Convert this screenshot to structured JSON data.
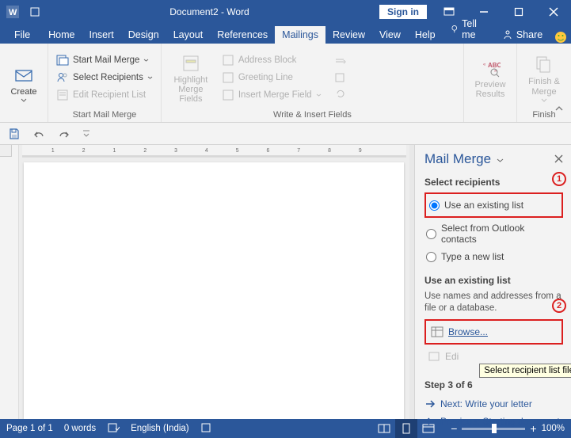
{
  "titlebar": {
    "title": "Document2 - Word",
    "signin": "Sign in"
  },
  "tabs": {
    "file": "File",
    "home": "Home",
    "insert": "Insert",
    "design": "Design",
    "layout": "Layout",
    "references": "References",
    "mailings": "Mailings",
    "review": "Review",
    "view": "View",
    "help": "Help",
    "tellme": "Tell me",
    "share": "Share"
  },
  "ribbon": {
    "create": {
      "label": "Create",
      "group": ""
    },
    "start_mail_merge": {
      "start": "Start Mail Merge",
      "select_recipients": "Select Recipients",
      "edit_recipient_list": "Edit Recipient List",
      "group": "Start Mail Merge"
    },
    "write_insert": {
      "highlight": "Highlight Merge Fields",
      "address_block": "Address Block",
      "greeting_line": "Greeting Line",
      "insert_merge_field": "Insert Merge Field",
      "group": "Write & Insert Fields"
    },
    "preview": {
      "label": "Preview Results"
    },
    "finish": {
      "label": "Finish & Merge",
      "group": "Finish"
    }
  },
  "sidepane": {
    "title": "Mail Merge",
    "select_recipients": "Select recipients",
    "opt_existing": "Use an existing list",
    "opt_outlook": "Select from Outlook contacts",
    "opt_type_new": "Type a new list",
    "use_existing_title": "Use an existing list",
    "use_existing_desc": "Use names and addresses from a file or a database.",
    "browse": "Browse...",
    "edit": "Edi",
    "step_title": "Step 3 of 6",
    "next": "Next: Write your letter",
    "prev": "Previous: Starting document",
    "tooltip": "Select recipient list file",
    "marker1": "1",
    "marker2": "2"
  },
  "statusbar": {
    "page": "Page 1 of 1",
    "words": "0 words",
    "lang": "English (India)",
    "zoom_pct": "100%"
  }
}
